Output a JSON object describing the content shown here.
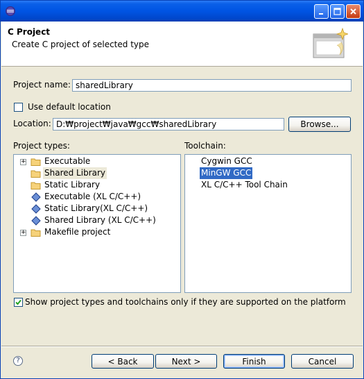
{
  "window": {
    "title": ""
  },
  "header": {
    "title": "C Project",
    "description": "Create C project of selected type"
  },
  "form": {
    "project_name_label": "Project name:",
    "project_name_value": "sharedLibrary",
    "use_default_location_label": "Use default location",
    "use_default_location_checked": false,
    "location_label": "Location:",
    "location_value": "D:₩project₩java₩gcc₩sharedLibrary",
    "browse_label": "Browse..."
  },
  "project_types": {
    "label": "Project types:",
    "items": [
      {
        "label": "Executable",
        "icon": "folder-icon",
        "expandable": true,
        "selected": false
      },
      {
        "label": "Shared Library",
        "icon": "folder-icon",
        "expandable": false,
        "selected": true
      },
      {
        "label": "Static Library",
        "icon": "folder-icon",
        "expandable": false,
        "selected": false
      },
      {
        "label": "Executable (XL C/C++)",
        "icon": "diamond-icon",
        "expandable": false,
        "selected": false
      },
      {
        "label": "Static Library(XL C/C++)",
        "icon": "diamond-icon",
        "expandable": false,
        "selected": false
      },
      {
        "label": "Shared Library (XL C/C++)",
        "icon": "diamond-icon",
        "expandable": false,
        "selected": false
      },
      {
        "label": "Makefile project",
        "icon": "folder-icon",
        "expandable": true,
        "selected": false
      }
    ]
  },
  "toolchain": {
    "label": "Toolchain:",
    "items": [
      {
        "label": "Cygwin GCC",
        "selected": false
      },
      {
        "label": "MinGW GCC",
        "selected": true
      },
      {
        "label": "XL C/C++ Tool Chain",
        "selected": false
      }
    ]
  },
  "filter": {
    "label": "Show project types and toolchains only if they are supported on the platform",
    "checked": true
  },
  "buttons": {
    "back": "< Back",
    "next": "Next >",
    "finish": "Finish",
    "cancel": "Cancel"
  },
  "colors": {
    "title_bar": "#0054e3",
    "selection": "#316ac5",
    "dialog_bg": "#ece9d8"
  }
}
